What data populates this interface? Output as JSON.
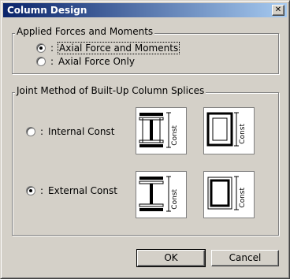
{
  "window": {
    "title": "Column Design",
    "close_glyph": "✕"
  },
  "forces_group": {
    "label": "Applied Forces and Moments",
    "options": [
      {
        "label": "Axial Force and Moments",
        "checked": true
      },
      {
        "label": "Axial Force Only",
        "checked": false
      }
    ]
  },
  "splice_group": {
    "label": "Joint Method of Built-Up Column Splices",
    "options": [
      {
        "label": "Internal Const",
        "checked": false
      },
      {
        "label": "External Const",
        "checked": true
      }
    ],
    "diagram_label": "Const",
    "separator": ":"
  },
  "buttons": {
    "ok": "OK",
    "cancel": "Cancel"
  }
}
